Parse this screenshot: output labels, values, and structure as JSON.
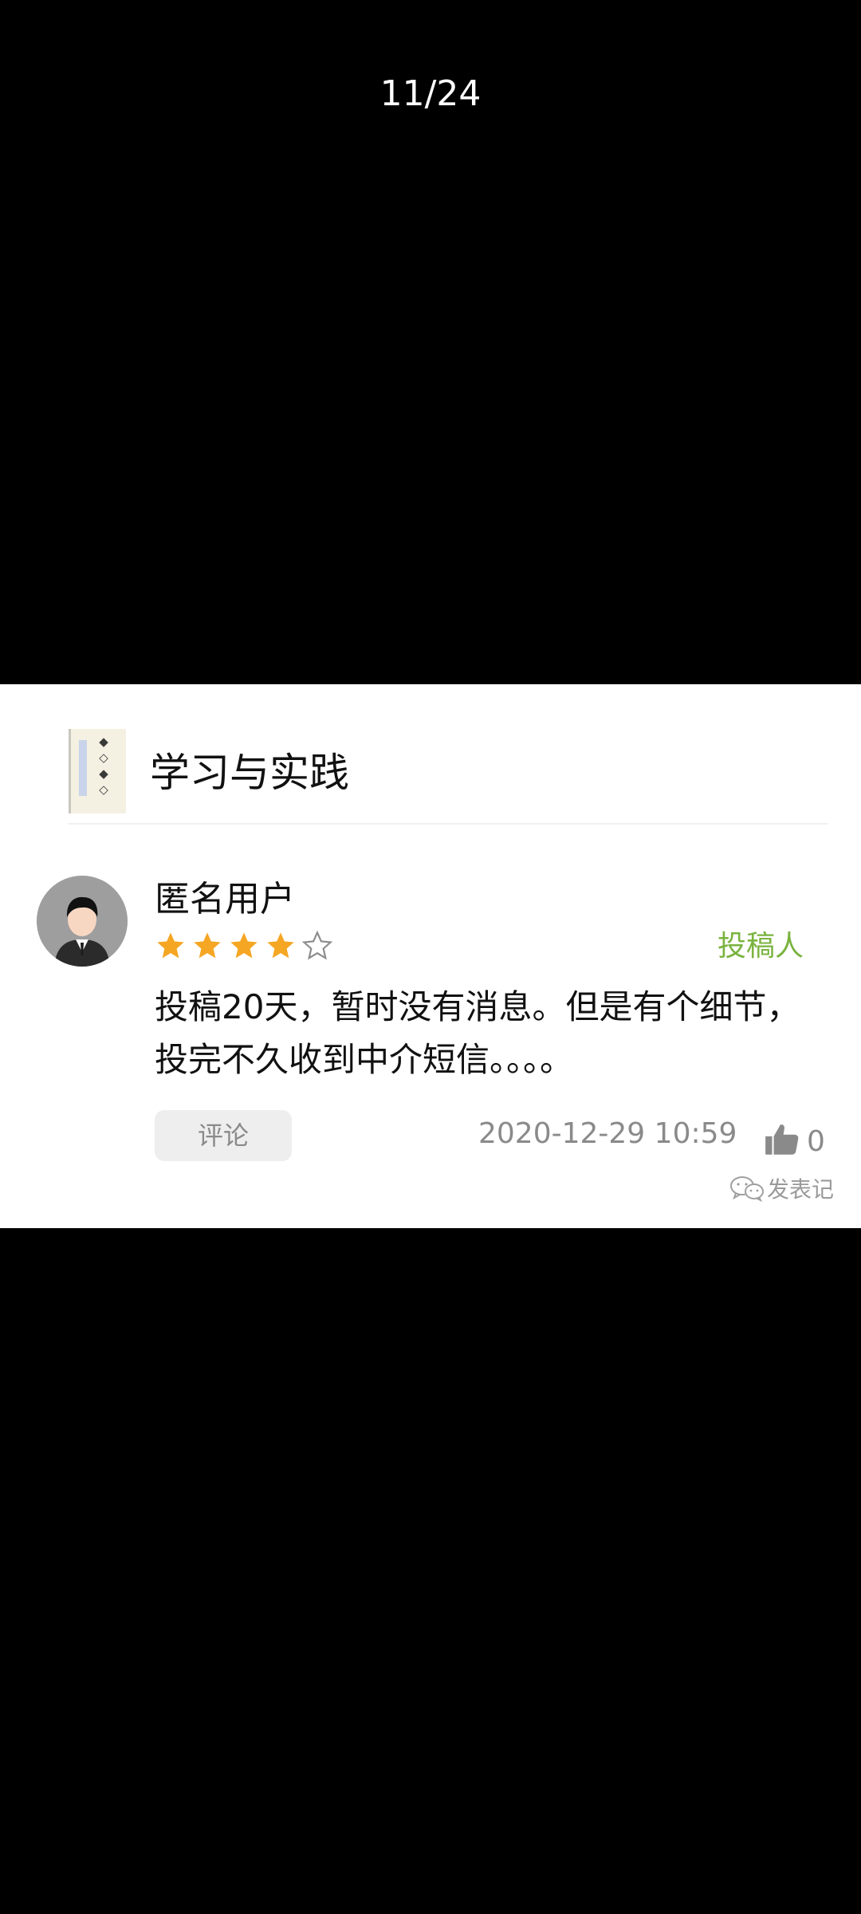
{
  "viewer": {
    "counter": "11/24"
  },
  "journal": {
    "title": "学习与实践",
    "cover_icon": "journal-cover-thumbnail"
  },
  "review": {
    "username": "匿名用户",
    "avatar_icon": "user-avatar-icon",
    "rating": 4,
    "rating_max": 5,
    "role": "投稿人",
    "text": "投稿20天，暂时没有消息。但是有个细节，投完不久收到中介短信。。。。",
    "comment_label": "评论",
    "timestamp": "2020-12-29 10:59",
    "like_count": "0"
  },
  "watermark": {
    "text": "发表记",
    "icon": "wechat-icon"
  },
  "colors": {
    "star_filled": "#f5a623",
    "star_empty": "#8c8c8c",
    "role_green": "#7ab33f",
    "muted_text": "#8a8a8a",
    "button_bg": "#eeeeee"
  }
}
